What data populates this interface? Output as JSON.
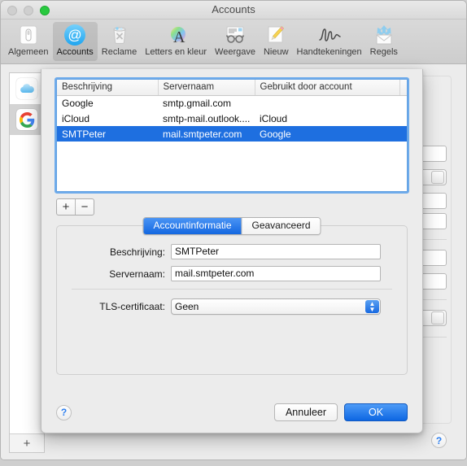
{
  "window": {
    "title": "Accounts",
    "traffic_lights": [
      "close",
      "minimize",
      "zoom"
    ]
  },
  "toolbar": {
    "items": [
      {
        "label": "Algemeen",
        "icon": "general-switch-icon",
        "selected": false
      },
      {
        "label": "Accounts",
        "icon": "at-sign-icon",
        "selected": true
      },
      {
        "label": "Reclame",
        "icon": "junk-trash-icon",
        "selected": false
      },
      {
        "label": "Letters en kleur",
        "icon": "fonts-colors-a-icon",
        "selected": false
      },
      {
        "label": "Weergave",
        "icon": "viewing-glasses-icon",
        "selected": false
      },
      {
        "label": "Nieuw",
        "icon": "compose-pencil-icon",
        "selected": false
      },
      {
        "label": "Handtekeningen",
        "icon": "signature-icon",
        "selected": false
      },
      {
        "label": "Regels",
        "icon": "rules-envelope-icon",
        "selected": false
      }
    ]
  },
  "background": {
    "accounts": [
      {
        "name": "iCloud",
        "icon": "icloud-icon",
        "active": false
      },
      {
        "name": "Google",
        "icon": "google-g-icon",
        "active": true
      }
    ],
    "add_account_label": "+",
    "help_label": "?"
  },
  "sheet": {
    "table": {
      "columns": [
        "Beschrijving",
        "Servernaam",
        "Gebruikt door account"
      ],
      "rows": [
        {
          "beschrijving": "Google",
          "servernaam": "smtp.gmail.com",
          "account": "",
          "selected": false
        },
        {
          "beschrijving": "iCloud",
          "servernaam": "smtp-mail.outlook....",
          "account": "iCloud",
          "selected": false
        },
        {
          "beschrijving": "SMTPeter",
          "servernaam": "mail.smtpeter.com",
          "account": "Google",
          "selected": true
        }
      ]
    },
    "list_controls": {
      "add_label": "+",
      "remove_label": "−"
    },
    "tabs": [
      {
        "label": "Accountinformatie",
        "active": true
      },
      {
        "label": "Geavanceerd",
        "active": false
      }
    ],
    "fields": {
      "beschrijving_label": "Beschrijving:",
      "beschrijving_value": "SMTPeter",
      "servernaam_label": "Servernaam:",
      "servernaam_value": "mail.smtpeter.com",
      "tls_label": "TLS-certificaat:",
      "tls_value": "Geen"
    },
    "footer": {
      "help_label": "?",
      "cancel_label": "Annuleer",
      "ok_label": "OK"
    }
  },
  "colors": {
    "selection_blue": "#1e6fe0",
    "accent_blue": "#0d66e2",
    "focus_ring": "#58a0eb",
    "window_bg": "#ececec"
  }
}
